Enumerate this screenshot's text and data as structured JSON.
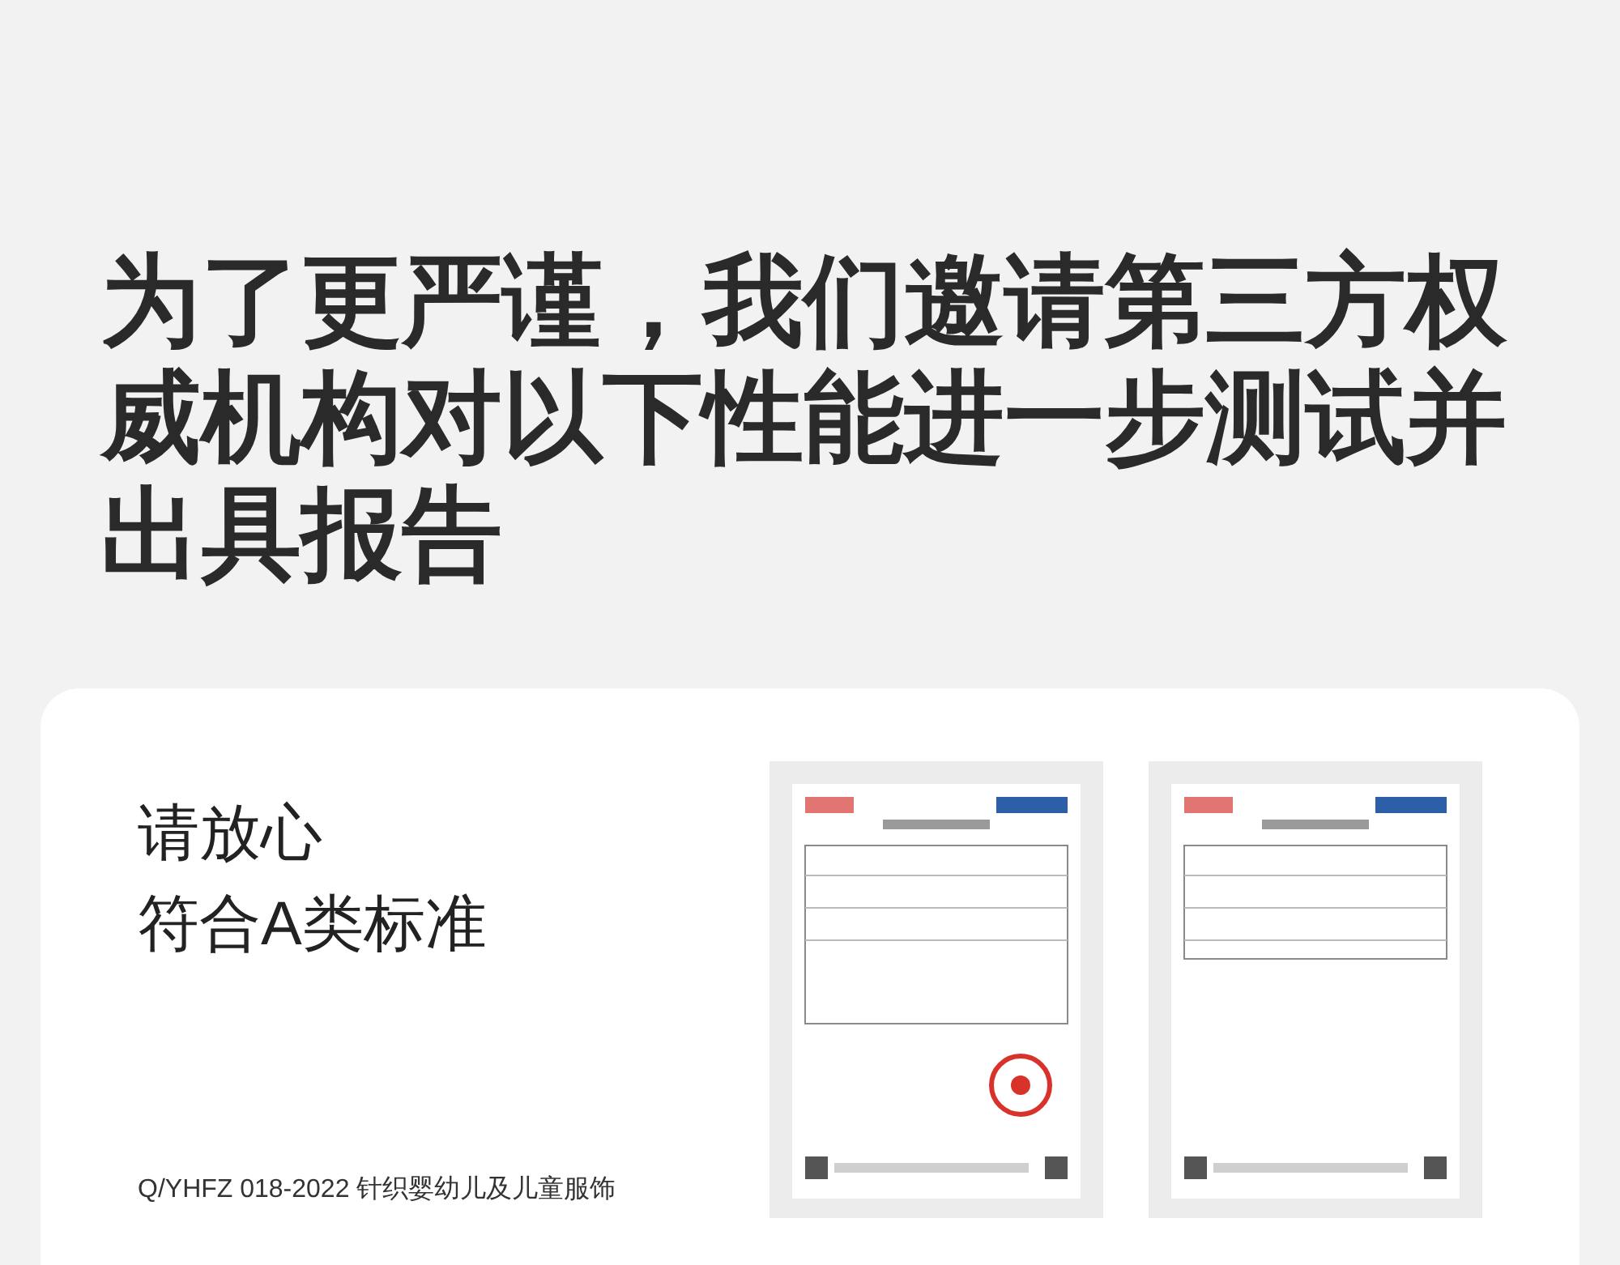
{
  "headline": "为了更严谨，我们邀请第三方权威机构对以下性能进一步测试并出具报告",
  "card": {
    "heading_lines": [
      "请放心",
      "符合A类标准"
    ],
    "standard": "Q/YHFZ 018-2022 针织婴幼儿及儿童服饰"
  }
}
